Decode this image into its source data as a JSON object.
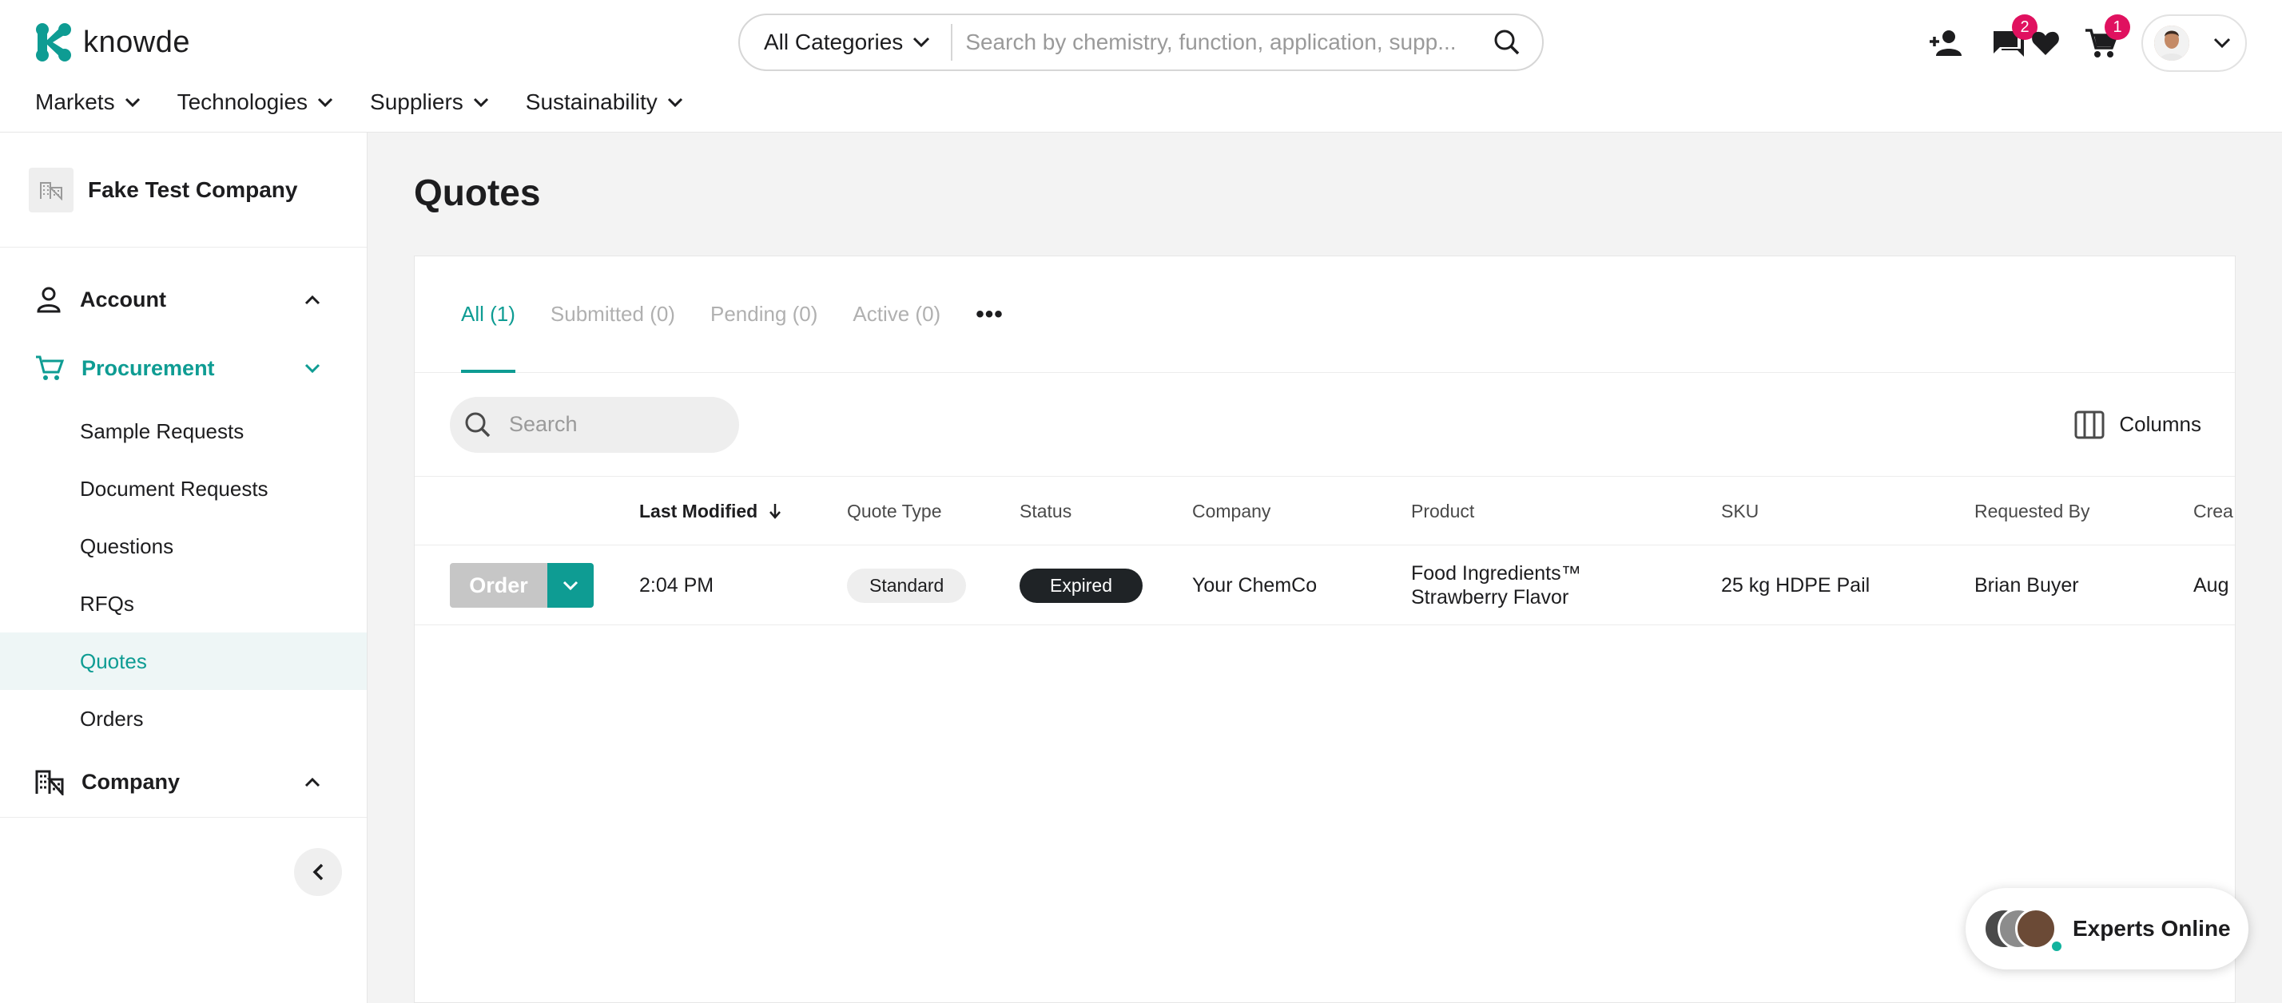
{
  "header": {
    "brand": "knowde",
    "category_label": "All Categories",
    "search_placeholder": "Search by chemistry, function, application, supp...",
    "messages_badge": "2",
    "cart_badge": "1",
    "nav": [
      "Markets",
      "Technologies",
      "Suppliers",
      "Sustainability"
    ]
  },
  "sidebar": {
    "company_name": "Fake Test Company",
    "account_label": "Account",
    "procurement_label": "Procurement",
    "procurement_items": [
      "Sample Requests",
      "Document Requests",
      "Questions",
      "RFQs",
      "Quotes",
      "Orders"
    ],
    "active_item": "Quotes",
    "company_label": "Company"
  },
  "main": {
    "title": "Quotes",
    "tabs": [
      "All (1)",
      "Submitted (0)",
      "Pending (0)",
      "Active (0)"
    ],
    "tab_more": "•••",
    "search_placeholder": "Search",
    "columns_label": "Columns",
    "table": {
      "headers": [
        "Last Modified",
        "Quote Type",
        "Status",
        "Company",
        "Product",
        "SKU",
        "Requested By",
        "Crea"
      ],
      "rows": [
        {
          "action_label": "Order",
          "last_modified": "2:04 PM",
          "quote_type": "Standard",
          "status": "Expired",
          "company": "Your ChemCo",
          "product_line1": "Food Ingredients™",
          "product_line2": "Strawberry Flavor",
          "sku": "25 kg HDPE Pail",
          "requested_by": "Brian Buyer",
          "created": "Aug"
        }
      ]
    }
  },
  "experts": {
    "label": "Experts Online"
  },
  "colors": {
    "accent": "#0e9c93",
    "badge": "#e0115f",
    "status_dark": "#1f2326"
  }
}
